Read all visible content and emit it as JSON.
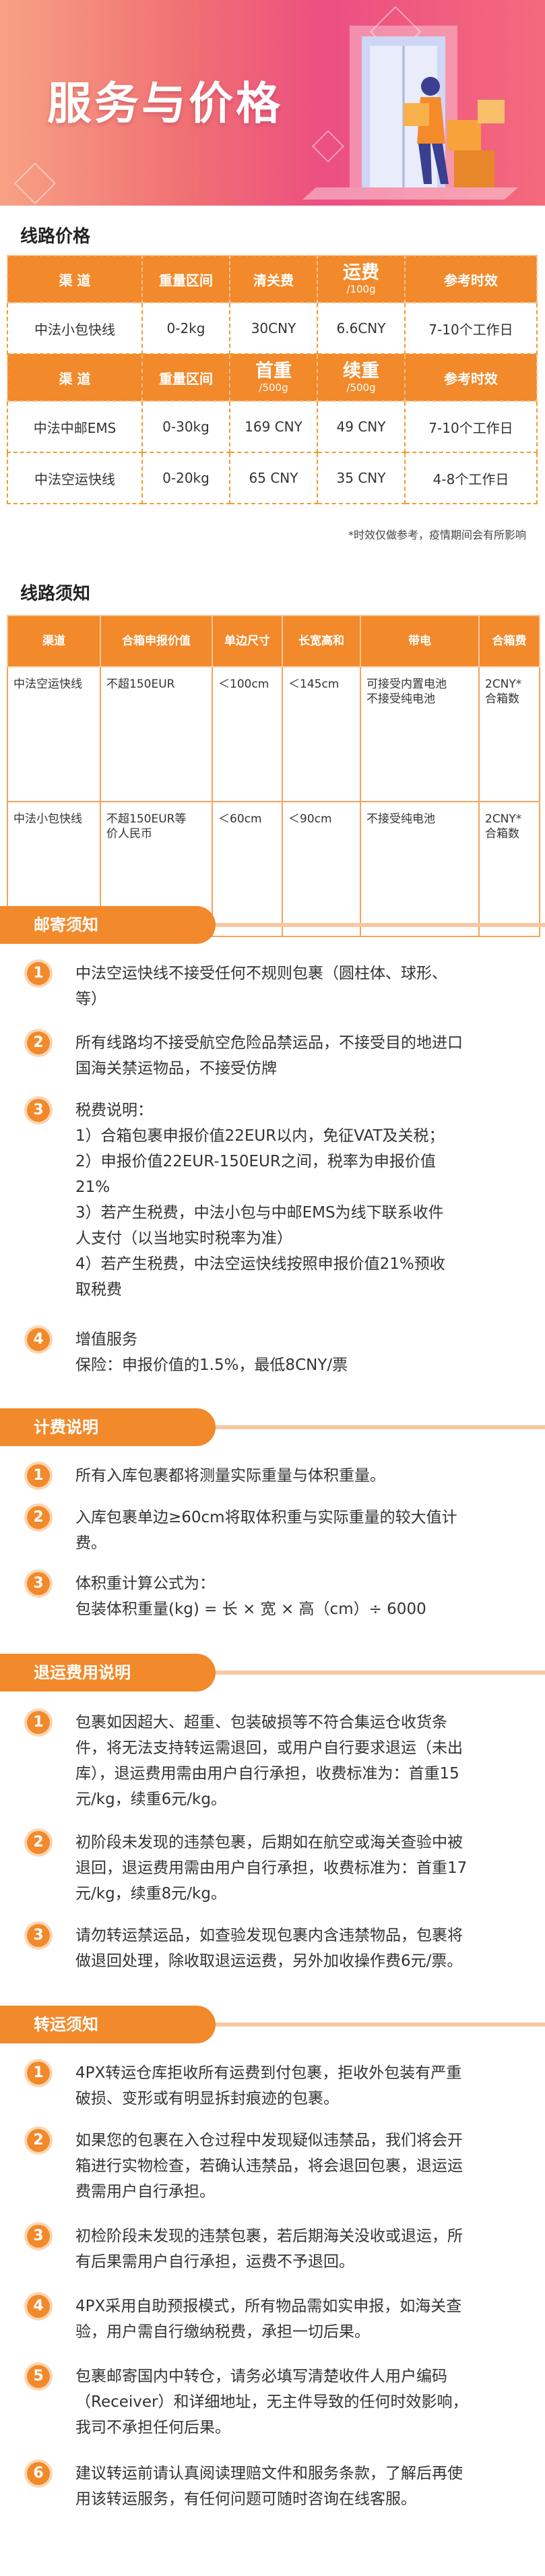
{
  "banner": {
    "title": "服务与价格"
  },
  "price": {
    "section_title": "线路价格",
    "header1": {
      "channel": "渠 道",
      "weight": "重量区间",
      "clearance": "清关费",
      "freight": "运费",
      "freight_unit": "/100g",
      "time": "参考时效"
    },
    "row1": {
      "channel": "中法小包快线",
      "weight": "0-2kg",
      "clearance": "30CNY",
      "freight": "6.6CNY",
      "time": "7-10个工作日"
    },
    "header2": {
      "channel": "渠 道",
      "weight": "重量区间",
      "first": "首重",
      "first_unit": "/500g",
      "extra": "续重",
      "extra_unit": "/500g",
      "time": "参考时效"
    },
    "row2": {
      "channel": "中法中邮EMS",
      "weight": "0-30kg",
      "first": "169 CNY",
      "extra": "49 CNY",
      "time": "7-10个工作日"
    },
    "row3": {
      "channel": "中法空运快线",
      "weight": "0-20kg",
      "first": "65 CNY",
      "extra": "35 CNY",
      "time": "4-8个工作日"
    },
    "note": "*时效仅做参考，疫情期间会有所影响"
  },
  "route": {
    "section_title": "线路须知",
    "headers": [
      "渠道",
      "合箱申报价值",
      "单边尺寸",
      "长宽高和",
      "带电",
      "合箱费"
    ],
    "rows": [
      [
        "中法空运快线",
        "不超150EUR",
        "＜100cm",
        "＜145cm",
        "可接受内置电池\n不接受纯电池",
        "2CNY*\n合箱数"
      ],
      [
        "中法小包快线",
        "不超150EUR等\n价人民币",
        "＜60cm",
        "＜90cm",
        "不接受纯电池",
        "2CNY*\n合箱数"
      ]
    ]
  },
  "mail": {
    "title": "邮寄须知",
    "items": [
      "中法空运快线不接受任何不规则包裹（圆柱体、球形、\n等）",
      "所有线路均不接受航空危险品禁运品，不接受目的地进口\n国海关禁运物品，不接受仿牌",
      "税费说明：\n1）合箱包裹申报价值22EUR以内，免征VAT及关税；\n2）申报价值22EUR-150EUR之间，税率为申报价值\n21%\n3）若产生税费，中法小包与中邮EMS为线下联系收件\n人支付（以当地实时税率为准）\n4）若产生税费，中法空运快线按照申报价值21%预收\n取税费",
      "增值服务\n保险：申报价值的1.5%，最低8CNY/票"
    ]
  },
  "billing": {
    "title": "计费说明",
    "items": [
      "所有入库包裹都将测量实际重量与体积重量。",
      "入库包裹单边≥60cm将取体积重与实际重量的较大值计\n费。",
      "体积重计算公式为：\n包装体积重量(kg) = 长 × 宽 × 高（cm）÷ 6000"
    ]
  },
  "refund": {
    "title": "退运费用说明",
    "items": [
      "包裹如因超大、超重、包装破损等不符合集运仓收货条\n件，将无法支持转运需退回，或用户自行要求退运（未出\n库），退运费用需由用户自行承担，收费标准为：首重15\n元/kg，续重6元/kg。",
      "初阶段未发现的违禁包裹，后期如在航空或海关查验中被\n退回，退运费用需由用户自行承担，收费标准为：首重17\n元/kg，续重8元/kg。",
      "请勿转运禁运品，如查验发现包裹内含违禁物品，包裹将\n做退回处理，除收取退运运费，另外加收操作费6元/票。"
    ]
  },
  "transfer": {
    "title": "转运须知",
    "items": [
      "4PX转运仓库拒收所有运费到付包裹，拒收外包装有严重\n破损、变形或有明显拆封痕迹的包裹。",
      "如果您的包裹在入仓过程中发现疑似违禁品，我们将会开\n箱进行实物检查，若确认违禁品，将会退回包裹，退运运\n费需用户自行承担。",
      "初检阶段未发现的违禁包裹，若后期海关没收或退运，所\n有后果需用户自行承担，运费不予退回。",
      "4PX采用自助预报模式，所有物品需如实申报，如海关查\n验，用户需自行缴纳税费，承担一切后果。",
      "包裹邮寄国内中转仓，请务必填写清楚收件人用户编码\n（Receiver）和详细地址，无主件导致的任何时效影响，\n我司不承担任何后果。",
      "建议转运前请认真阅读理赔文件和服务条款，了解后再使\n用该转运服务，有任何问题可随时咨询在线客服。"
    ]
  },
  "colors": {
    "accent": "#f2892a",
    "banner_pink": "#ec4f82"
  }
}
